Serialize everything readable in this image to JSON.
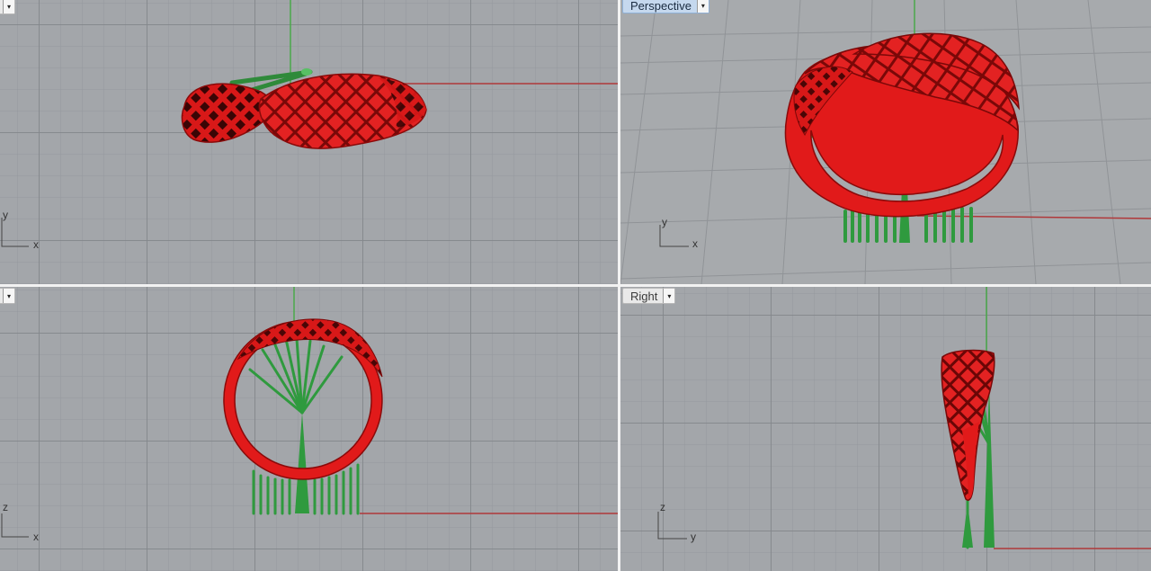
{
  "viewports": {
    "top": {
      "tab_label": "",
      "axis": {
        "vertical": "y",
        "horizontal": "x"
      }
    },
    "perspective": {
      "tab_label": "Perspective",
      "axis": {
        "vertical": "y",
        "horizontal": "x"
      }
    },
    "front": {
      "tab_label": "",
      "axis": {
        "vertical": "z",
        "horizontal": "x"
      }
    },
    "right": {
      "tab_label": "Right",
      "axis": {
        "vertical": "z",
        "horizontal": "y"
      }
    }
  },
  "icons": {
    "menu_arrow": "▾"
  },
  "colors": {
    "ring_red": "#e11a1a",
    "support_green": "#3ea64a",
    "axis_x_red": "#b0383a",
    "axis_y_green": "#4aa84a",
    "active_tab_blue": "#c5d8ee"
  }
}
